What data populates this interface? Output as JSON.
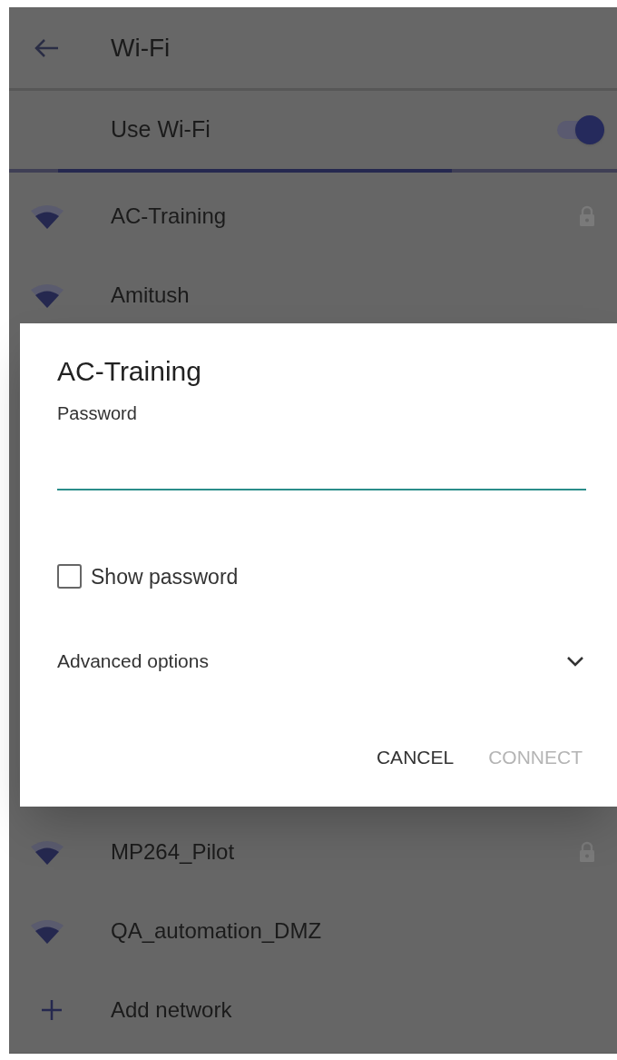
{
  "app_bar": {
    "title": "Wi-Fi"
  },
  "use_wifi": {
    "label": "Use Wi-Fi",
    "on": true,
    "scanning": true
  },
  "networks": [
    {
      "name": "AC-Training",
      "locked": true
    },
    {
      "name": "Amitush",
      "locked": false
    },
    {
      "name": "MP264_Pilot",
      "locked": true
    },
    {
      "name": "QA_automation_DMZ",
      "locked": false
    }
  ],
  "add_network": {
    "label": "Add network"
  },
  "dialog": {
    "title": "AC-Training",
    "password_label": "Password",
    "show_password": {
      "label": "Show password",
      "checked": false
    },
    "advanced_options": {
      "label": "Advanced options",
      "expanded": false
    },
    "buttons": [
      {
        "label": "CANCEL",
        "disabled": false
      },
      {
        "label": "CONNECT",
        "disabled": true
      }
    ]
  }
}
